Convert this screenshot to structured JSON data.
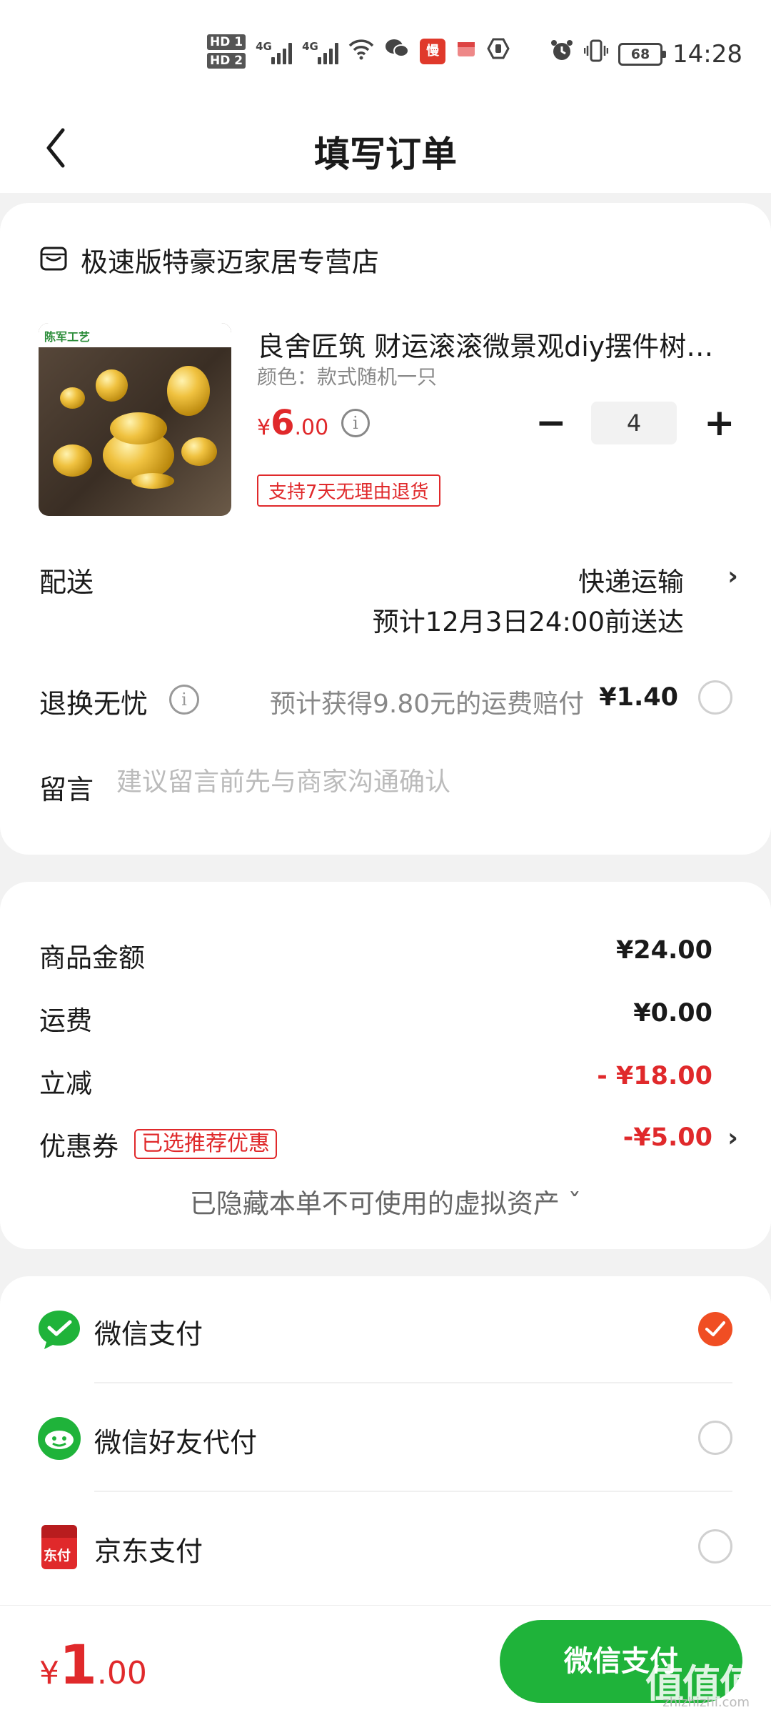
{
  "status_bar": {
    "hd1": "HD 1",
    "hd2": "HD 2",
    "net1": "4G",
    "net2": "4G",
    "battery": "68",
    "time": "14:28"
  },
  "nav": {
    "title": "填写订单"
  },
  "store": {
    "name": "极速版特豪迈家居专营店"
  },
  "product": {
    "brand_text": "陈军工艺",
    "title": "良舍匠筑 财运滚滚微景观diy摆件树…",
    "spec": "颜色：款式随机一只",
    "currency": "¥",
    "price_int": "6",
    "price_dec": ".00",
    "quantity": "4",
    "minus": "−",
    "plus": "+",
    "return_tag": "支持7天无理由退货"
  },
  "shipping": {
    "label": "配送",
    "method": "快递运输",
    "eta": "预计12月3日24:00前送达"
  },
  "worry_free": {
    "label": "退换无忧",
    "desc": "预计获得9.80元的运费赔付",
    "price": "¥1.40"
  },
  "message": {
    "label": "留言",
    "placeholder": "建议留言前先与商家沟通确认"
  },
  "summary": {
    "goods_label": "商品金额",
    "goods_value": "¥24.00",
    "freight_label": "运费",
    "freight_value": "¥0.00",
    "discount_label": "立减",
    "discount_value": "- ¥18.00",
    "coupon_label": "优惠券",
    "coupon_tag": "已选推荐优惠",
    "coupon_value": "-¥5.00",
    "hidden_note": "已隐藏本单不可使用的虚拟资产 ˇ"
  },
  "payment": {
    "methods": [
      {
        "label": "微信支付",
        "selected": true
      },
      {
        "label": "微信好友代付",
        "selected": false
      },
      {
        "label": "京东支付",
        "selected": false
      }
    ],
    "jd_icon_text": "东付"
  },
  "bottom": {
    "currency": "¥",
    "total_int": "1",
    "total_dec": ".00",
    "pay_button": "微信支付",
    "watermark": "值值值",
    "watermark_sub": "zhizhizhi.com"
  },
  "colors": {
    "accent_red": "#e0292b",
    "wechat_green": "#1fb33a",
    "check_orange": "#f04e23"
  }
}
